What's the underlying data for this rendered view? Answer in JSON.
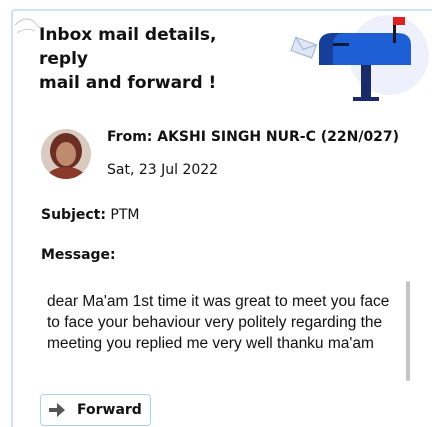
{
  "header": {
    "title": "Inbox mail details,\nreply\nmail and forward !"
  },
  "mail": {
    "from": "From: AKSHI SINGH NUR-C (22N/027)",
    "date": "Sat, 23 Jul 2022",
    "subject_label": "Subject:",
    "subject_value": "PTM",
    "message_label": "Message:",
    "message_body": "dear Ma'am 1st time it was great to meet you face to face your behaviour very politely regarding the meeting you replied me very well thanku ma'am"
  },
  "actions": {
    "forward_label": "Forward"
  },
  "icons": {
    "mailbox": "mailbox-illustration",
    "avatar": "sender-avatar",
    "forward": "arrow-right-icon"
  },
  "colors": {
    "accent_blue": "#1e57c8",
    "border_blue": "#a9d6e6",
    "flag_red": "#e02020"
  }
}
